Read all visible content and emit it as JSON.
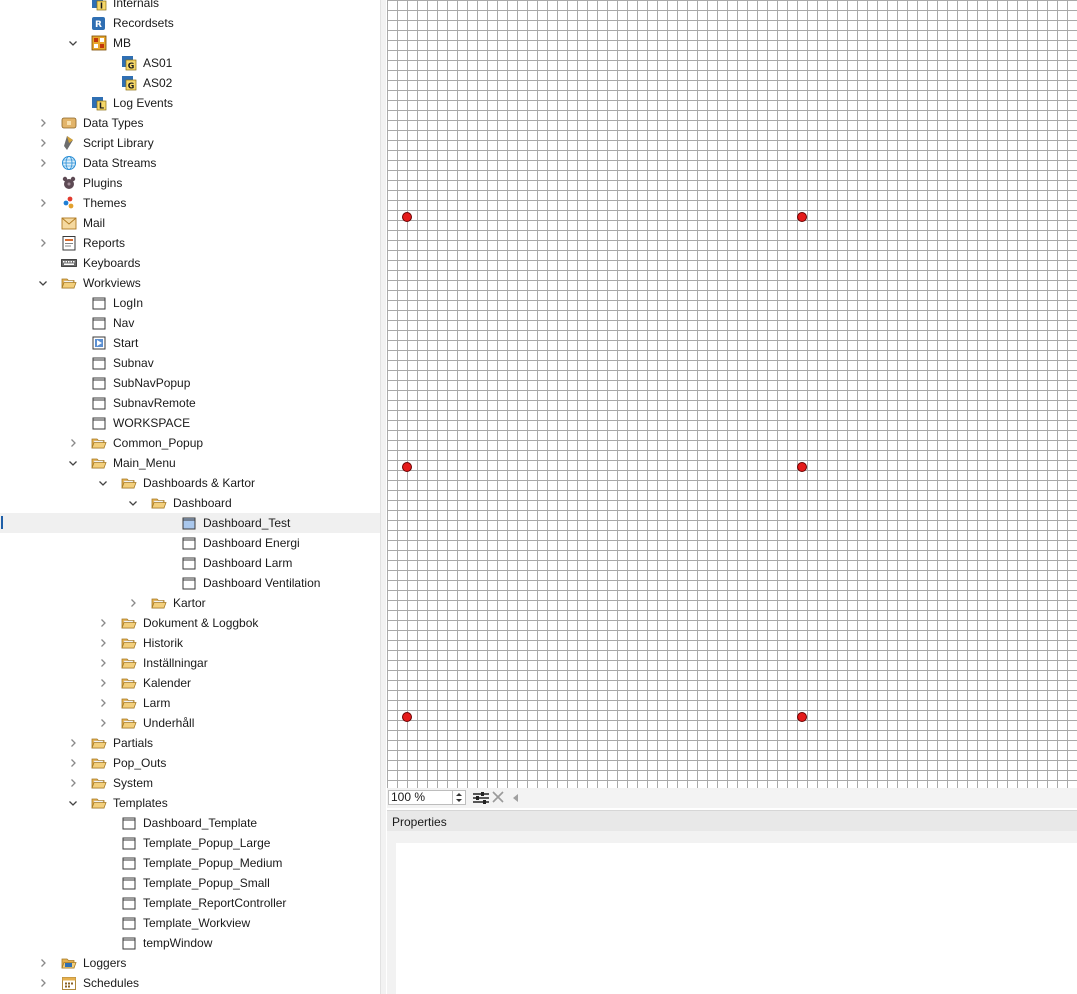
{
  "tree": [
    {
      "label": "Internals",
      "icon": "internals-icon",
      "level": 1,
      "chev": "none"
    },
    {
      "label": "Recordsets",
      "icon": "recordsets-icon",
      "level": 1,
      "chev": "none"
    },
    {
      "label": "MB",
      "icon": "mb-icon",
      "level": 1,
      "chev": "open"
    },
    {
      "label": "AS01",
      "icon": "group-icon",
      "level": 2,
      "chev": "none"
    },
    {
      "label": "AS02",
      "icon": "group-icon",
      "level": 2,
      "chev": "none"
    },
    {
      "label": "Log Events",
      "icon": "log-events-icon",
      "level": 1,
      "chev": "none"
    },
    {
      "label": "Data Types",
      "icon": "data-types-icon",
      "level": 0,
      "chev": "closed"
    },
    {
      "label": "Script Library",
      "icon": "script-library-icon",
      "level": 0,
      "chev": "closed"
    },
    {
      "label": "Data Streams",
      "icon": "globe-icon",
      "level": 0,
      "chev": "closed"
    },
    {
      "label": "Plugins",
      "icon": "plugins-icon",
      "level": 0,
      "chev": "none"
    },
    {
      "label": "Themes",
      "icon": "themes-icon",
      "level": 0,
      "chev": "closed"
    },
    {
      "label": "Mail",
      "icon": "mail-icon",
      "level": 0,
      "chev": "none"
    },
    {
      "label": "Reports",
      "icon": "reports-icon",
      "level": 0,
      "chev": "closed"
    },
    {
      "label": "Keyboards",
      "icon": "keyboard-icon",
      "level": 0,
      "chev": "none"
    },
    {
      "label": "Workviews",
      "icon": "folder-open-icon",
      "level": 0,
      "chev": "open"
    },
    {
      "label": "LogIn",
      "icon": "window-icon",
      "level": 1,
      "chev": "none"
    },
    {
      "label": "Nav",
      "icon": "window-icon",
      "level": 1,
      "chev": "none"
    },
    {
      "label": "Start",
      "icon": "start-window-icon",
      "level": 1,
      "chev": "none"
    },
    {
      "label": "Subnav",
      "icon": "window-icon",
      "level": 1,
      "chev": "none"
    },
    {
      "label": "SubNavPopup",
      "icon": "window-icon",
      "level": 1,
      "chev": "none"
    },
    {
      "label": "SubnavRemote",
      "icon": "window-icon",
      "level": 1,
      "chev": "none"
    },
    {
      "label": "WORKSPACE",
      "icon": "window-icon",
      "level": 1,
      "chev": "none"
    },
    {
      "label": "Common_Popup",
      "icon": "folder-open-icon",
      "level": 1,
      "chev": "closed"
    },
    {
      "label": "Main_Menu",
      "icon": "folder-open-icon",
      "level": 1,
      "chev": "open"
    },
    {
      "label": "Dashboards & Kartor",
      "icon": "folder-open-icon",
      "level": 2,
      "chev": "open"
    },
    {
      "label": "Dashboard",
      "icon": "folder-open-icon",
      "level": 3,
      "chev": "open"
    },
    {
      "label": "Dashboard_Test",
      "icon": "window-selected-icon",
      "level": 4,
      "chev": "none",
      "selected": true
    },
    {
      "label": "Dashboard Energi",
      "icon": "window-icon",
      "level": 4,
      "chev": "none"
    },
    {
      "label": "Dashboard Larm",
      "icon": "window-icon",
      "level": 4,
      "chev": "none"
    },
    {
      "label": "Dashboard Ventilation",
      "icon": "window-icon",
      "level": 4,
      "chev": "none"
    },
    {
      "label": "Kartor",
      "icon": "folder-open-icon",
      "level": 3,
      "chev": "closed"
    },
    {
      "label": "Dokument & Loggbok",
      "icon": "folder-open-icon",
      "level": 2,
      "chev": "closed"
    },
    {
      "label": "Historik",
      "icon": "folder-open-icon",
      "level": 2,
      "chev": "closed"
    },
    {
      "label": "Inställningar",
      "icon": "folder-open-icon",
      "level": 2,
      "chev": "closed"
    },
    {
      "label": "Kalender",
      "icon": "folder-open-icon",
      "level": 2,
      "chev": "closed"
    },
    {
      "label": "Larm",
      "icon": "folder-open-icon",
      "level": 2,
      "chev": "closed"
    },
    {
      "label": "Underhåll",
      "icon": "folder-open-icon",
      "level": 2,
      "chev": "closed"
    },
    {
      "label": "Partials",
      "icon": "folder-open-icon",
      "level": 1,
      "chev": "closed"
    },
    {
      "label": "Pop_Outs",
      "icon": "folder-open-icon",
      "level": 1,
      "chev": "closed"
    },
    {
      "label": "System",
      "icon": "folder-open-icon",
      "level": 1,
      "chev": "closed"
    },
    {
      "label": "Templates",
      "icon": "folder-open-icon",
      "level": 1,
      "chev": "open"
    },
    {
      "label": "Dashboard_Template",
      "icon": "window-icon",
      "level": 2,
      "chev": "none"
    },
    {
      "label": "Template_Popup_Large",
      "icon": "window-icon",
      "level": 2,
      "chev": "none"
    },
    {
      "label": "Template_Popup_Medium",
      "icon": "window-icon",
      "level": 2,
      "chev": "none"
    },
    {
      "label": "Template_Popup_Small",
      "icon": "window-icon",
      "level": 2,
      "chev": "none"
    },
    {
      "label": "Template_ReportController",
      "icon": "window-icon",
      "level": 2,
      "chev": "none"
    },
    {
      "label": "Template_Workview",
      "icon": "window-icon",
      "level": 2,
      "chev": "none"
    },
    {
      "label": "tempWindow",
      "icon": "window-icon",
      "level": 2,
      "chev": "none"
    },
    {
      "label": "Loggers",
      "icon": "loggers-icon",
      "level": 0,
      "chev": "closed"
    },
    {
      "label": "Schedules",
      "icon": "schedules-icon",
      "level": 0,
      "chev": "closed"
    }
  ],
  "canvas": {
    "handles": [
      "top-left",
      "top-right",
      "middle-left",
      "middle-right",
      "bottom-left",
      "bottom-right"
    ],
    "handle_color": "#e51b1b",
    "grid_color": "#a9a9a9"
  },
  "zoombar": {
    "zoom_value": "100 %",
    "icons": [
      "zoom-stepper-icon",
      "fit-settings-icon",
      "clear-icon",
      "collapse-left-icon"
    ]
  },
  "properties": {
    "title": "Properties"
  },
  "colors": {
    "folder": "#f0c36a",
    "selected_row": "#f0f0f0",
    "panel": "#f2f2f2"
  }
}
